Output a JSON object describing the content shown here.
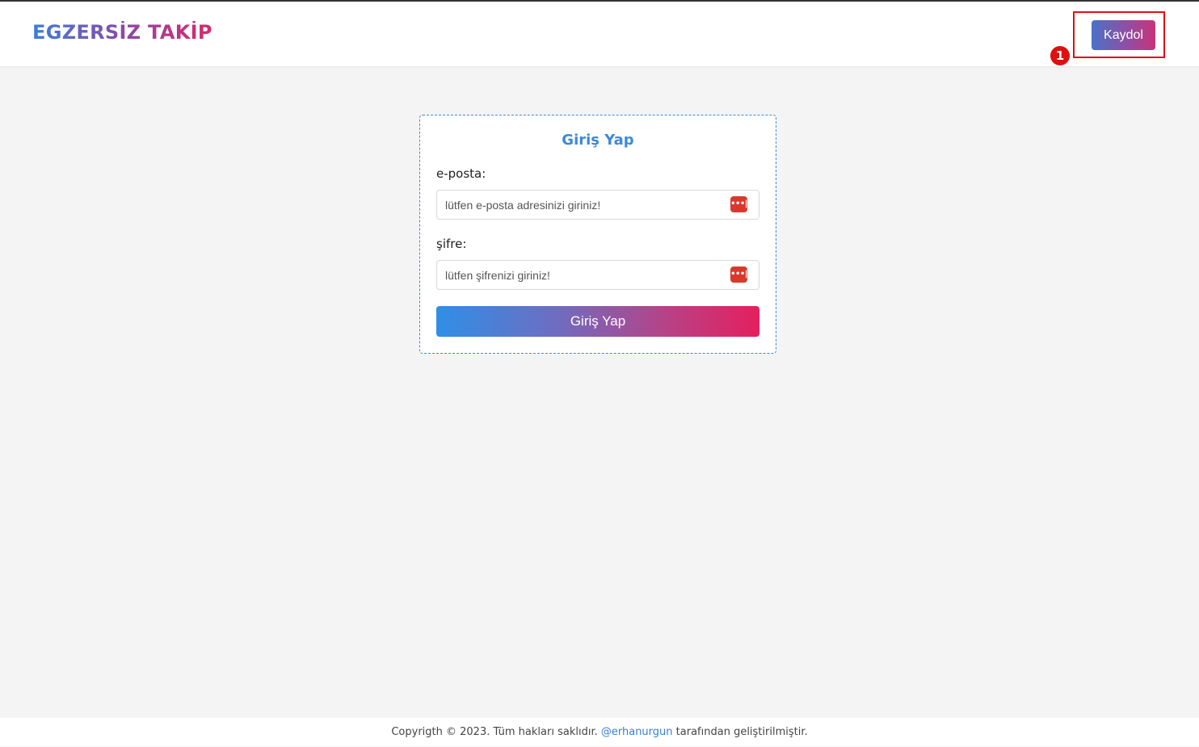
{
  "header": {
    "logo_text": "EGZERSİZ TAKİP",
    "register_button_label": "Kaydol",
    "annotation_number": "1"
  },
  "login_form": {
    "title": "Giriş Yap",
    "email_label": "e-posta:",
    "email_placeholder": "lütfen e-posta adresinizi giriniz!",
    "email_value": "",
    "password_label": "şifre:",
    "password_placeholder": "lütfen şifrenizi giriniz!",
    "password_value": "",
    "password_manager_icon": "password-manager-icon",
    "password_manager_glyph": "•••|",
    "submit_label": "Giriş Yap"
  },
  "footer": {
    "copyright_prefix": "Copyrigth © 2023. Tüm hakları saklıdır.",
    "author_link": "@erhanurgun",
    "copyright_suffix": "tarafından geliştirilmiştir."
  },
  "colors": {
    "accent_blue": "#3a8ad6",
    "accent_pink": "#e51f5d",
    "annotation_red": "#e01010",
    "background": "#f4f4f4"
  }
}
